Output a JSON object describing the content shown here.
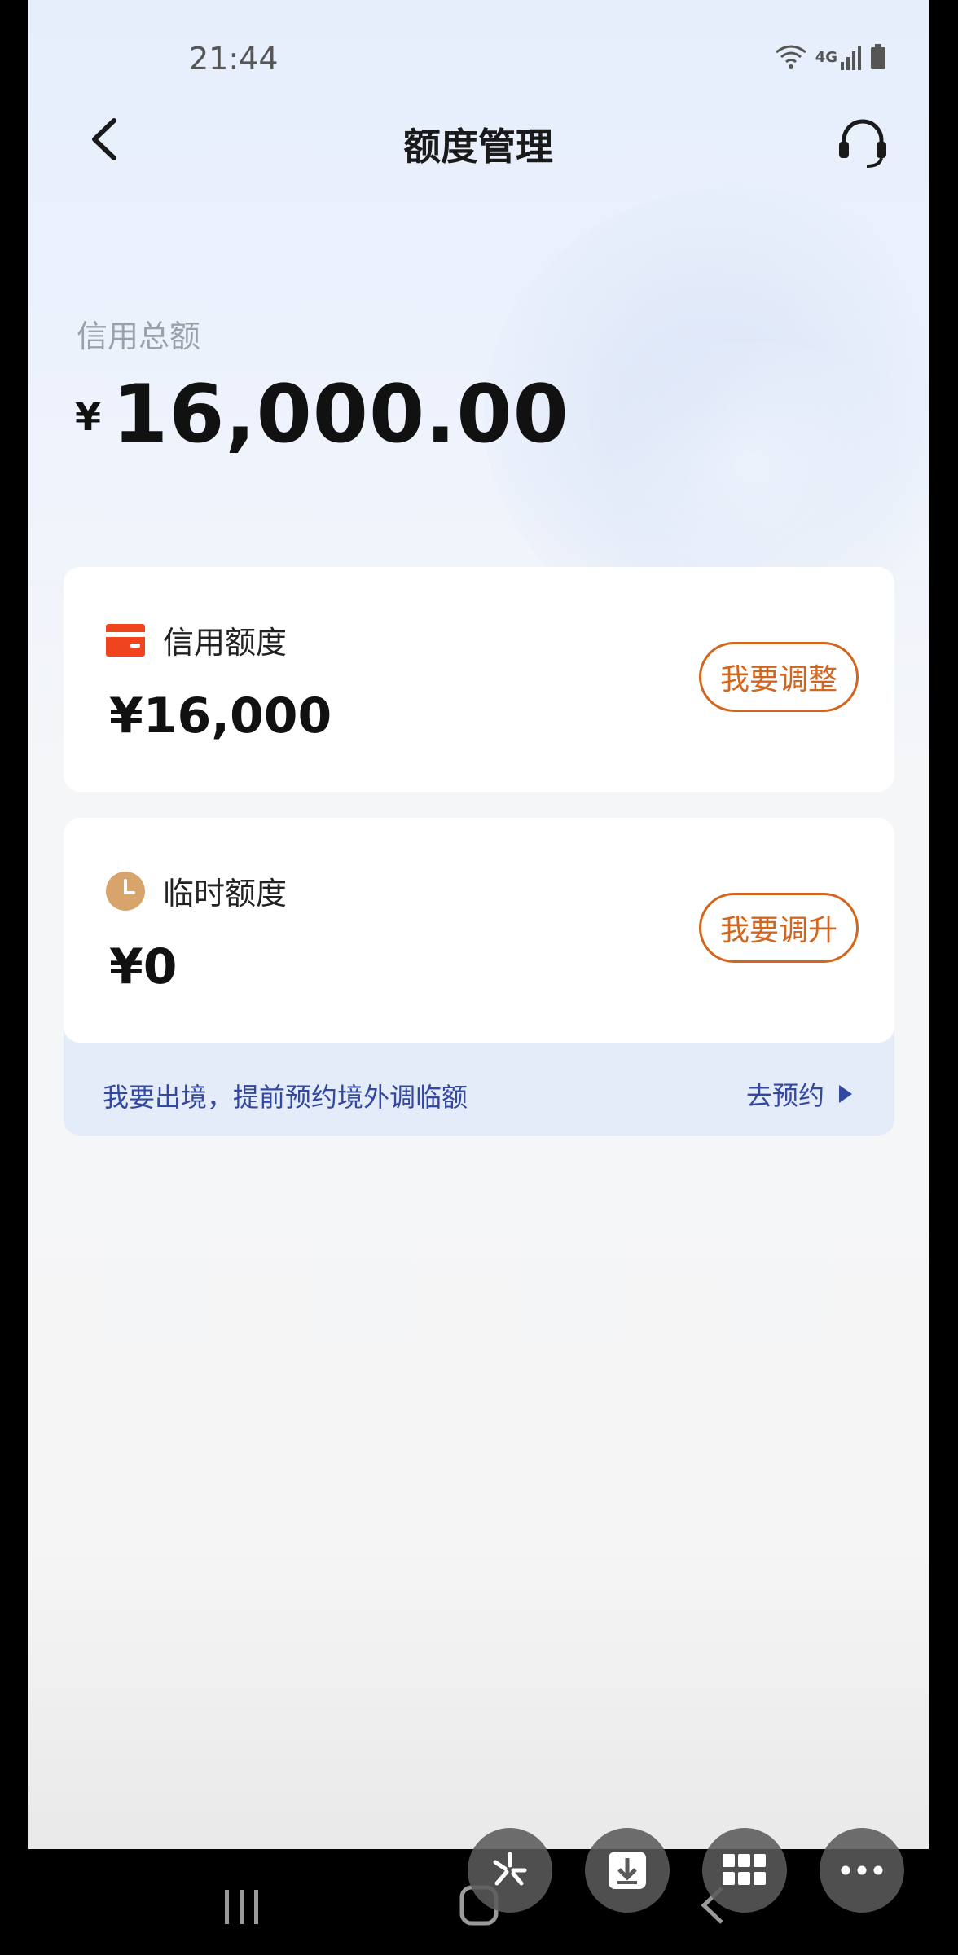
{
  "status_bar": {
    "time": "21:44",
    "network": "4G"
  },
  "header": {
    "title": "额度管理"
  },
  "total": {
    "label": "信用总额",
    "currency": "¥",
    "amount": "16,000.00"
  },
  "credit_card": {
    "label": "信用额度",
    "value": "¥16,000",
    "button": "我要调整",
    "icon_color": "#f0441e"
  },
  "temp_card": {
    "label": "临时额度",
    "value": "¥0",
    "button": "我要调升",
    "icon_color": "#d7a46c"
  },
  "abroad": {
    "text": "我要出境，提前预约境外调临额",
    "link": "去预约"
  },
  "colors": {
    "accent": "#d2661f",
    "link": "#3348a0"
  }
}
